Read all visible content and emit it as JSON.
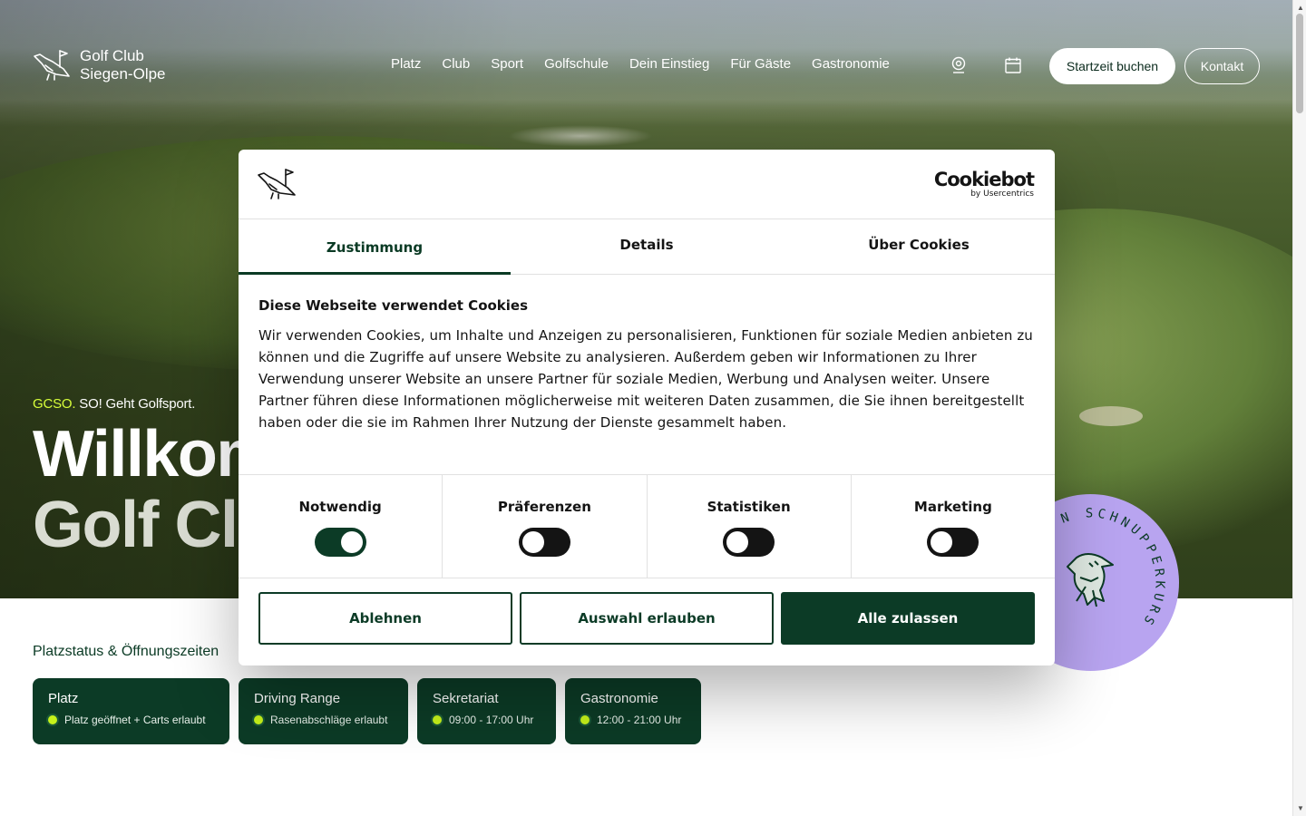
{
  "site": {
    "logo_line1": "Golf Club",
    "logo_line2": "Siegen-Olpe"
  },
  "nav": {
    "items": [
      "Platz",
      "Club",
      "Sport",
      "Golfschule",
      "Dein Einstieg",
      "Für Gäste",
      "Gastronomie"
    ],
    "book_button": "Startzeit buchen",
    "contact_button": "Kontakt"
  },
  "hero": {
    "tagline_brand": "GCSO.",
    "tagline_text": " SO! Geht Golfsport.",
    "headline_line1": "Willkommen",
    "headline_line2": "Golf Club"
  },
  "status": {
    "title": "Platzstatus & Öffnungszeiten",
    "cards": [
      {
        "title": "Platz",
        "status": "Platz geöffnet + Carts erlaubt"
      },
      {
        "title": "Driving Range",
        "status": "Rasenabschläge erlaubt"
      },
      {
        "title": "Sekretariat",
        "status": "09:00 - 17:00 Uhr"
      },
      {
        "title": "Gastronomie",
        "status": "12:00 - 21:00 Uhr"
      }
    ],
    "status_color": "#c6f21a"
  },
  "badge": {
    "text": "N SCHNUPPERKURS",
    "color": "#b8a4f0"
  },
  "cookie": {
    "brand": "Cookiebot",
    "brand_sub": "by Usercentrics",
    "tabs": [
      "Zustimmung",
      "Details",
      "Über Cookies"
    ],
    "active_tab": "Zustimmung",
    "heading": "Diese Webseite verwendet Cookies",
    "text": "Wir verwenden Cookies, um Inhalte und Anzeigen zu personalisieren, Funktionen für soziale Medien anbieten zu können und die Zugriffe auf unsere Website zu analysieren. Außerdem geben wir Informationen zu Ihrer Verwendung unserer Website an unsere Partner für soziale Medien, Werbung und Analysen weiter. Unsere Partner führen diese Informationen möglicherweise mit weiteren Daten zusammen, die Sie ihnen bereitgestellt haben oder die sie im Rahmen Ihrer Nutzung der Dienste gesammelt haben.",
    "categories": [
      {
        "label": "Notwendig",
        "enabled": true
      },
      {
        "label": "Präferenzen",
        "enabled": false
      },
      {
        "label": "Statistiken",
        "enabled": false
      },
      {
        "label": "Marketing",
        "enabled": false
      }
    ],
    "buttons": {
      "decline": "Ablehnen",
      "allow_selection": "Auswahl erlauben",
      "allow_all": "Alle zulassen"
    },
    "accent_color": "#0c3b26"
  }
}
